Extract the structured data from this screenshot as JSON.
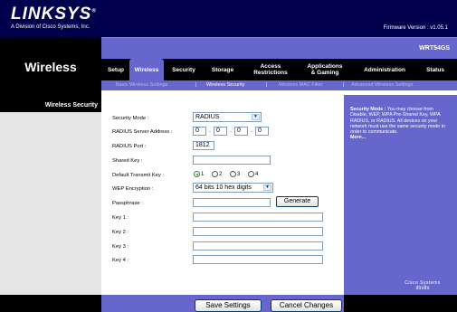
{
  "header": {
    "logo": "LINKSYS",
    "logo_registered": "®",
    "logo_sub": "A Division of Cisco Systems, Inc.",
    "firmware": "Firmware Version : v1.05.1",
    "model": "WRT54GS"
  },
  "page_title": "Wireless",
  "tabs": [
    {
      "label": "Setup"
    },
    {
      "label": "Wireless"
    },
    {
      "label": "Security"
    },
    {
      "label": "Storage"
    },
    {
      "label_line1": "Access",
      "label_line2": "Restrictions"
    },
    {
      "label_line1": "Applications",
      "label_line2": "& Gaming"
    },
    {
      "label": "Administration"
    },
    {
      "label": "Status"
    }
  ],
  "subtabs": [
    {
      "label": "Basic Wireless Settings"
    },
    {
      "label": "Wireless Security"
    },
    {
      "label": "Wireless MAC Filter"
    },
    {
      "label": "Advanced Wireless Settings"
    }
  ],
  "subtab_separator": "|",
  "section_label": "Wireless Security",
  "form": {
    "security_mode_label": "Security Mode :",
    "security_mode_value": "RADIUS",
    "radius_address_label": "RADIUS Server Address :",
    "radius_address": [
      "0",
      "0",
      "0",
      "0"
    ],
    "radius_port_label": "RADIUS Port :",
    "radius_port": "1812",
    "shared_key_label": "Shared Key :",
    "shared_key": "",
    "default_key_label": "Default Transmit  Key :",
    "default_key_options": [
      "1",
      "2",
      "3",
      "4"
    ],
    "default_key_selected": "1",
    "wep_label": "WEP Encryption :",
    "wep_value": "64 bits 10 hex digits",
    "passphrase_label": "Passphrase :",
    "passphrase": "",
    "generate_label": "Generate",
    "key1_label": "Key 1 :",
    "key2_label": "Key 2 :",
    "key3_label": "Key 3 :",
    "key4_label": "Key 4 :",
    "dot": "."
  },
  "help": {
    "title": "Security Mode :",
    "text": " You may choose from Disable, WEP, WPA Pre-Shared Key, WPA RADIUS, or RADIUS. All devices on your network must use the same security mode in order to communicate.",
    "more": "More..."
  },
  "cisco": {
    "name": "Cisco Systems",
    "bars": "ıllıııllıı"
  },
  "footer": {
    "save": "Save Settings",
    "cancel": "Cancel Changes"
  },
  "colors": {
    "navy": "#00004d",
    "purple": "#6666cc",
    "black": "#000000",
    "grey": "#e6e6e6"
  },
  "icons": {
    "select_arrow": "chevron-down-icon",
    "radio": "radio-icon"
  }
}
